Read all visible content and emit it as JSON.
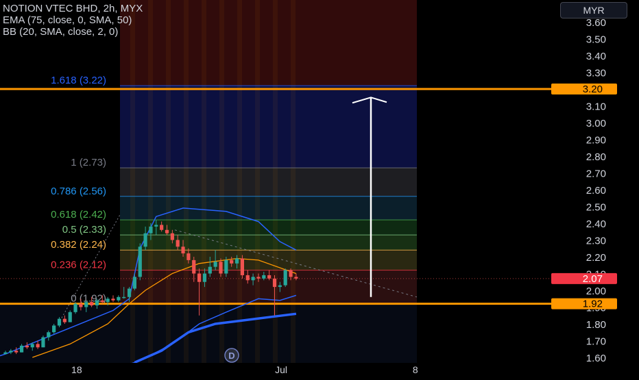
{
  "legend": {
    "title": "NOTION VTEC BHD, 2h, MYX",
    "ema": "EMA (75, close, 0, SMA, 50)",
    "bb": "BB (20, SMA, close, 2, 0)"
  },
  "currency_button": "MYR",
  "colors": {
    "background": "#000000",
    "axis_text": "#d1d4dc",
    "up": "#26a69a",
    "down": "#ef5350",
    "bb_band": "#2962ff",
    "ema": "#ff9800",
    "ema_long": "#2962ff",
    "horizontal_line": "#ff9800",
    "arrow": "#ffffff",
    "fib_level_1618": "#2962ff",
    "fib_level_1": "#787b86",
    "fib_level_0786": "#2196f3",
    "fib_level_0618": "#4caf50",
    "fib_level_05": "#81c784",
    "fib_level_0382": "#ffb74d",
    "fib_level_0236": "#f23645",
    "fib_level_0": "#9598a1"
  },
  "chart_data": {
    "type": "candlestick",
    "y_axis": {
      "min": 1.6,
      "max": 3.6,
      "ticks": [
        "3.60",
        "3.50",
        "3.40",
        "3.30",
        "3.20",
        "3.10",
        "3.00",
        "2.90",
        "2.80",
        "2.70",
        "2.60",
        "2.50",
        "2.40",
        "2.30",
        "2.20",
        "2.10",
        "2.00",
        "1.90",
        "1.80",
        "1.70",
        "1.60"
      ]
    },
    "x_axis": {
      "ticks": [
        {
          "label": "18",
          "x": 0.12
        },
        {
          "label": "Jul",
          "x": 0.44
        },
        {
          "label": "8",
          "x": 0.65
        }
      ]
    },
    "price_labels": [
      {
        "value": 3.2,
        "text": "3.20",
        "style": "orange"
      },
      {
        "value": 2.07,
        "text": "2.07",
        "style": "red"
      },
      {
        "value": 1.92,
        "text": "1.92",
        "style": "orange"
      }
    ],
    "fib_levels": [
      {
        "ratio": "1.618",
        "value": 3.22,
        "label": "1.618 (3.22)"
      },
      {
        "ratio": "1",
        "value": 2.73,
        "label": "1 (2.73)"
      },
      {
        "ratio": "0.786",
        "value": 2.56,
        "label": "0.786 (2.56)"
      },
      {
        "ratio": "0.618",
        "value": 2.42,
        "label": "0.618 (2.42)"
      },
      {
        "ratio": "0.5",
        "value": 2.33,
        "label": "0.5 (2.33)"
      },
      {
        "ratio": "0.382",
        "value": 2.24,
        "label": "0.382 (2.24)"
      },
      {
        "ratio": "0.236",
        "value": 2.12,
        "label": "0.236 (2.12)"
      },
      {
        "ratio": "0",
        "value": 1.92,
        "label": "0 (1.92)"
      }
    ],
    "horizontal_lines": [
      3.2,
      1.92
    ],
    "last_price": 2.07,
    "arrow": {
      "from": 1.96,
      "to": 3.15
    },
    "dividend_marker": "D",
    "candles": [
      {
        "o": 1.62,
        "h": 1.64,
        "l": 1.62,
        "c": 1.63
      },
      {
        "o": 1.63,
        "h": 1.65,
        "l": 1.62,
        "c": 1.64
      },
      {
        "o": 1.64,
        "h": 1.66,
        "l": 1.62,
        "c": 1.63
      },
      {
        "o": 1.63,
        "h": 1.68,
        "l": 1.63,
        "c": 1.67
      },
      {
        "o": 1.67,
        "h": 1.69,
        "l": 1.65,
        "c": 1.66
      },
      {
        "o": 1.66,
        "h": 1.69,
        "l": 1.64,
        "c": 1.68
      },
      {
        "o": 1.68,
        "h": 1.7,
        "l": 1.65,
        "c": 1.66
      },
      {
        "o": 1.66,
        "h": 1.73,
        "l": 1.66,
        "c": 1.72
      },
      {
        "o": 1.72,
        "h": 1.76,
        "l": 1.7,
        "c": 1.75
      },
      {
        "o": 1.75,
        "h": 1.8,
        "l": 1.74,
        "c": 1.79
      },
      {
        "o": 1.79,
        "h": 1.84,
        "l": 1.78,
        "c": 1.83
      },
      {
        "o": 1.83,
        "h": 1.85,
        "l": 1.8,
        "c": 1.81
      },
      {
        "o": 1.81,
        "h": 1.88,
        "l": 1.81,
        "c": 1.87
      },
      {
        "o": 1.87,
        "h": 1.93,
        "l": 1.86,
        "c": 1.92
      },
      {
        "o": 1.92,
        "h": 1.95,
        "l": 1.88,
        "c": 1.9
      },
      {
        "o": 1.9,
        "h": 1.94,
        "l": 1.87,
        "c": 1.93
      },
      {
        "o": 1.93,
        "h": 1.96,
        "l": 1.9,
        "c": 1.91
      },
      {
        "o": 1.91,
        "h": 1.95,
        "l": 1.89,
        "c": 1.94
      },
      {
        "o": 1.94,
        "h": 1.97,
        "l": 1.92,
        "c": 1.93
      },
      {
        "o": 1.93,
        "h": 1.96,
        "l": 1.91,
        "c": 1.95
      },
      {
        "o": 1.95,
        "h": 1.97,
        "l": 1.93,
        "c": 1.94
      },
      {
        "o": 1.94,
        "h": 1.97,
        "l": 1.93,
        "c": 1.96
      },
      {
        "o": 1.96,
        "h": 2.02,
        "l": 1.95,
        "c": 1.96
      },
      {
        "o": 1.96,
        "h": 2.02,
        "l": 1.93,
        "c": 2.01
      },
      {
        "o": 2.01,
        "h": 2.1,
        "l": 2.0,
        "c": 2.08
      },
      {
        "o": 2.08,
        "h": 2.28,
        "l": 2.06,
        "c": 2.26
      },
      {
        "o": 2.26,
        "h": 2.38,
        "l": 2.24,
        "c": 2.34
      },
      {
        "o": 2.34,
        "h": 2.4,
        "l": 2.3,
        "c": 2.38
      },
      {
        "o": 2.38,
        "h": 2.42,
        "l": 2.33,
        "c": 2.39
      },
      {
        "o": 2.39,
        "h": 2.41,
        "l": 2.35,
        "c": 2.36
      },
      {
        "o": 2.36,
        "h": 2.39,
        "l": 2.33,
        "c": 2.34
      },
      {
        "o": 2.34,
        "h": 2.36,
        "l": 2.28,
        "c": 2.3
      },
      {
        "o": 2.3,
        "h": 2.33,
        "l": 2.24,
        "c": 2.26
      },
      {
        "o": 2.26,
        "h": 2.3,
        "l": 2.2,
        "c": 2.22
      },
      {
        "o": 2.22,
        "h": 2.25,
        "l": 2.16,
        "c": 2.18
      },
      {
        "o": 2.18,
        "h": 2.2,
        "l": 2.05,
        "c": 2.1
      },
      {
        "o": 2.1,
        "h": 2.13,
        "l": 1.85,
        "c": 2.05
      },
      {
        "o": 2.05,
        "h": 2.13,
        "l": 2.02,
        "c": 2.1
      },
      {
        "o": 2.1,
        "h": 2.2,
        "l": 2.08,
        "c": 2.14
      },
      {
        "o": 2.14,
        "h": 2.24,
        "l": 2.12,
        "c": 2.17
      },
      {
        "o": 2.17,
        "h": 2.19,
        "l": 2.08,
        "c": 2.1
      },
      {
        "o": 2.1,
        "h": 2.2,
        "l": 2.08,
        "c": 2.18
      },
      {
        "o": 2.18,
        "h": 2.2,
        "l": 2.14,
        "c": 2.16
      },
      {
        "o": 2.16,
        "h": 2.21,
        "l": 2.13,
        "c": 2.19
      },
      {
        "o": 2.19,
        "h": 2.21,
        "l": 2.07,
        "c": 2.09
      },
      {
        "o": 2.09,
        "h": 2.12,
        "l": 2.04,
        "c": 2.06
      },
      {
        "o": 2.06,
        "h": 2.1,
        "l": 2.03,
        "c": 2.08
      },
      {
        "o": 2.08,
        "h": 2.1,
        "l": 2.05,
        "c": 2.07
      },
      {
        "o": 2.07,
        "h": 2.11,
        "l": 2.06,
        "c": 2.09
      },
      {
        "o": 2.09,
        "h": 2.12,
        "l": 2.06,
        "c": 2.07
      },
      {
        "o": 2.07,
        "h": 2.09,
        "l": 1.85,
        "c": 2.02
      },
      {
        "o": 2.02,
        "h": 2.05,
        "l": 1.99,
        "c": 2.03
      },
      {
        "o": 2.03,
        "h": 2.13,
        "l": 2.02,
        "c": 2.12
      },
      {
        "o": 2.12,
        "h": 2.13,
        "l": 2.06,
        "c": 2.08
      },
      {
        "o": 2.08,
        "h": 2.1,
        "l": 2.06,
        "c": 2.07
      }
    ]
  }
}
